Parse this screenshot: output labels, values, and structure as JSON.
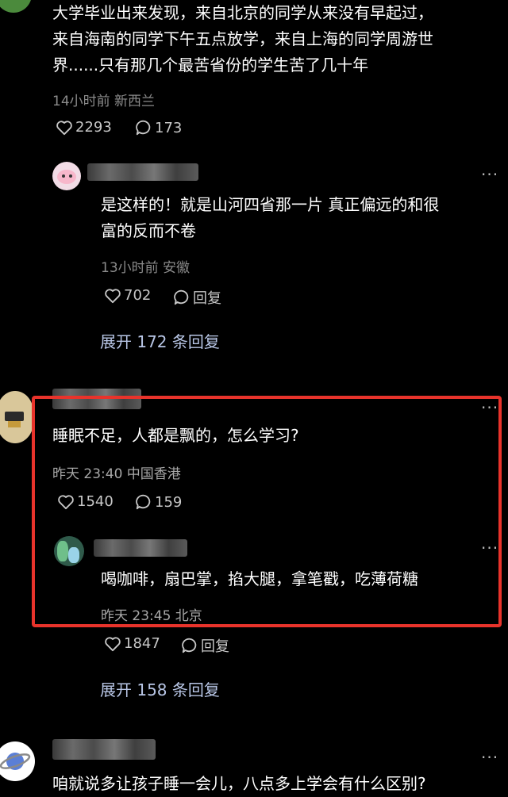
{
  "comment1": {
    "lines": [
      "大学毕业出来发现，来自北京的同学从来没有早起过，",
      "来自海南的同学下午五点放学，来自上海的同学周游世",
      "界......只有那几个最苦省份的学生苦了几十年"
    ],
    "meta": "14小时前 新西兰",
    "likes": "2293",
    "replies": "173"
  },
  "reply1": {
    "lines": [
      "是这样的！就是山河四省那一片 真正偏远的和很",
      "富的反而不卷"
    ],
    "meta": "13小时前 安徽",
    "likes": "702",
    "reply_label": "回复"
  },
  "expand1": "展开 172 条回复",
  "comment2": {
    "text": "睡眠不足，人都是飘的，怎么学习?",
    "meta": "昨天 23:40 中国香港",
    "likes": "1540",
    "replies": "159"
  },
  "reply2": {
    "text": "喝咖啡，扇巴掌，掐大腿，拿笔戳，吃薄荷糖",
    "meta": "昨天 23:45 北京",
    "likes": "1847",
    "reply_label": "回复"
  },
  "expand2": "展开 158 条回复",
  "comment3": {
    "text": "咱就说多让孩子睡一会儿，八点多上学会有什么区别?"
  },
  "more_glyph": "···",
  "colors": {
    "highlight": "#e8332b",
    "background": "#000000",
    "expand_link": "#b8c6e6"
  }
}
